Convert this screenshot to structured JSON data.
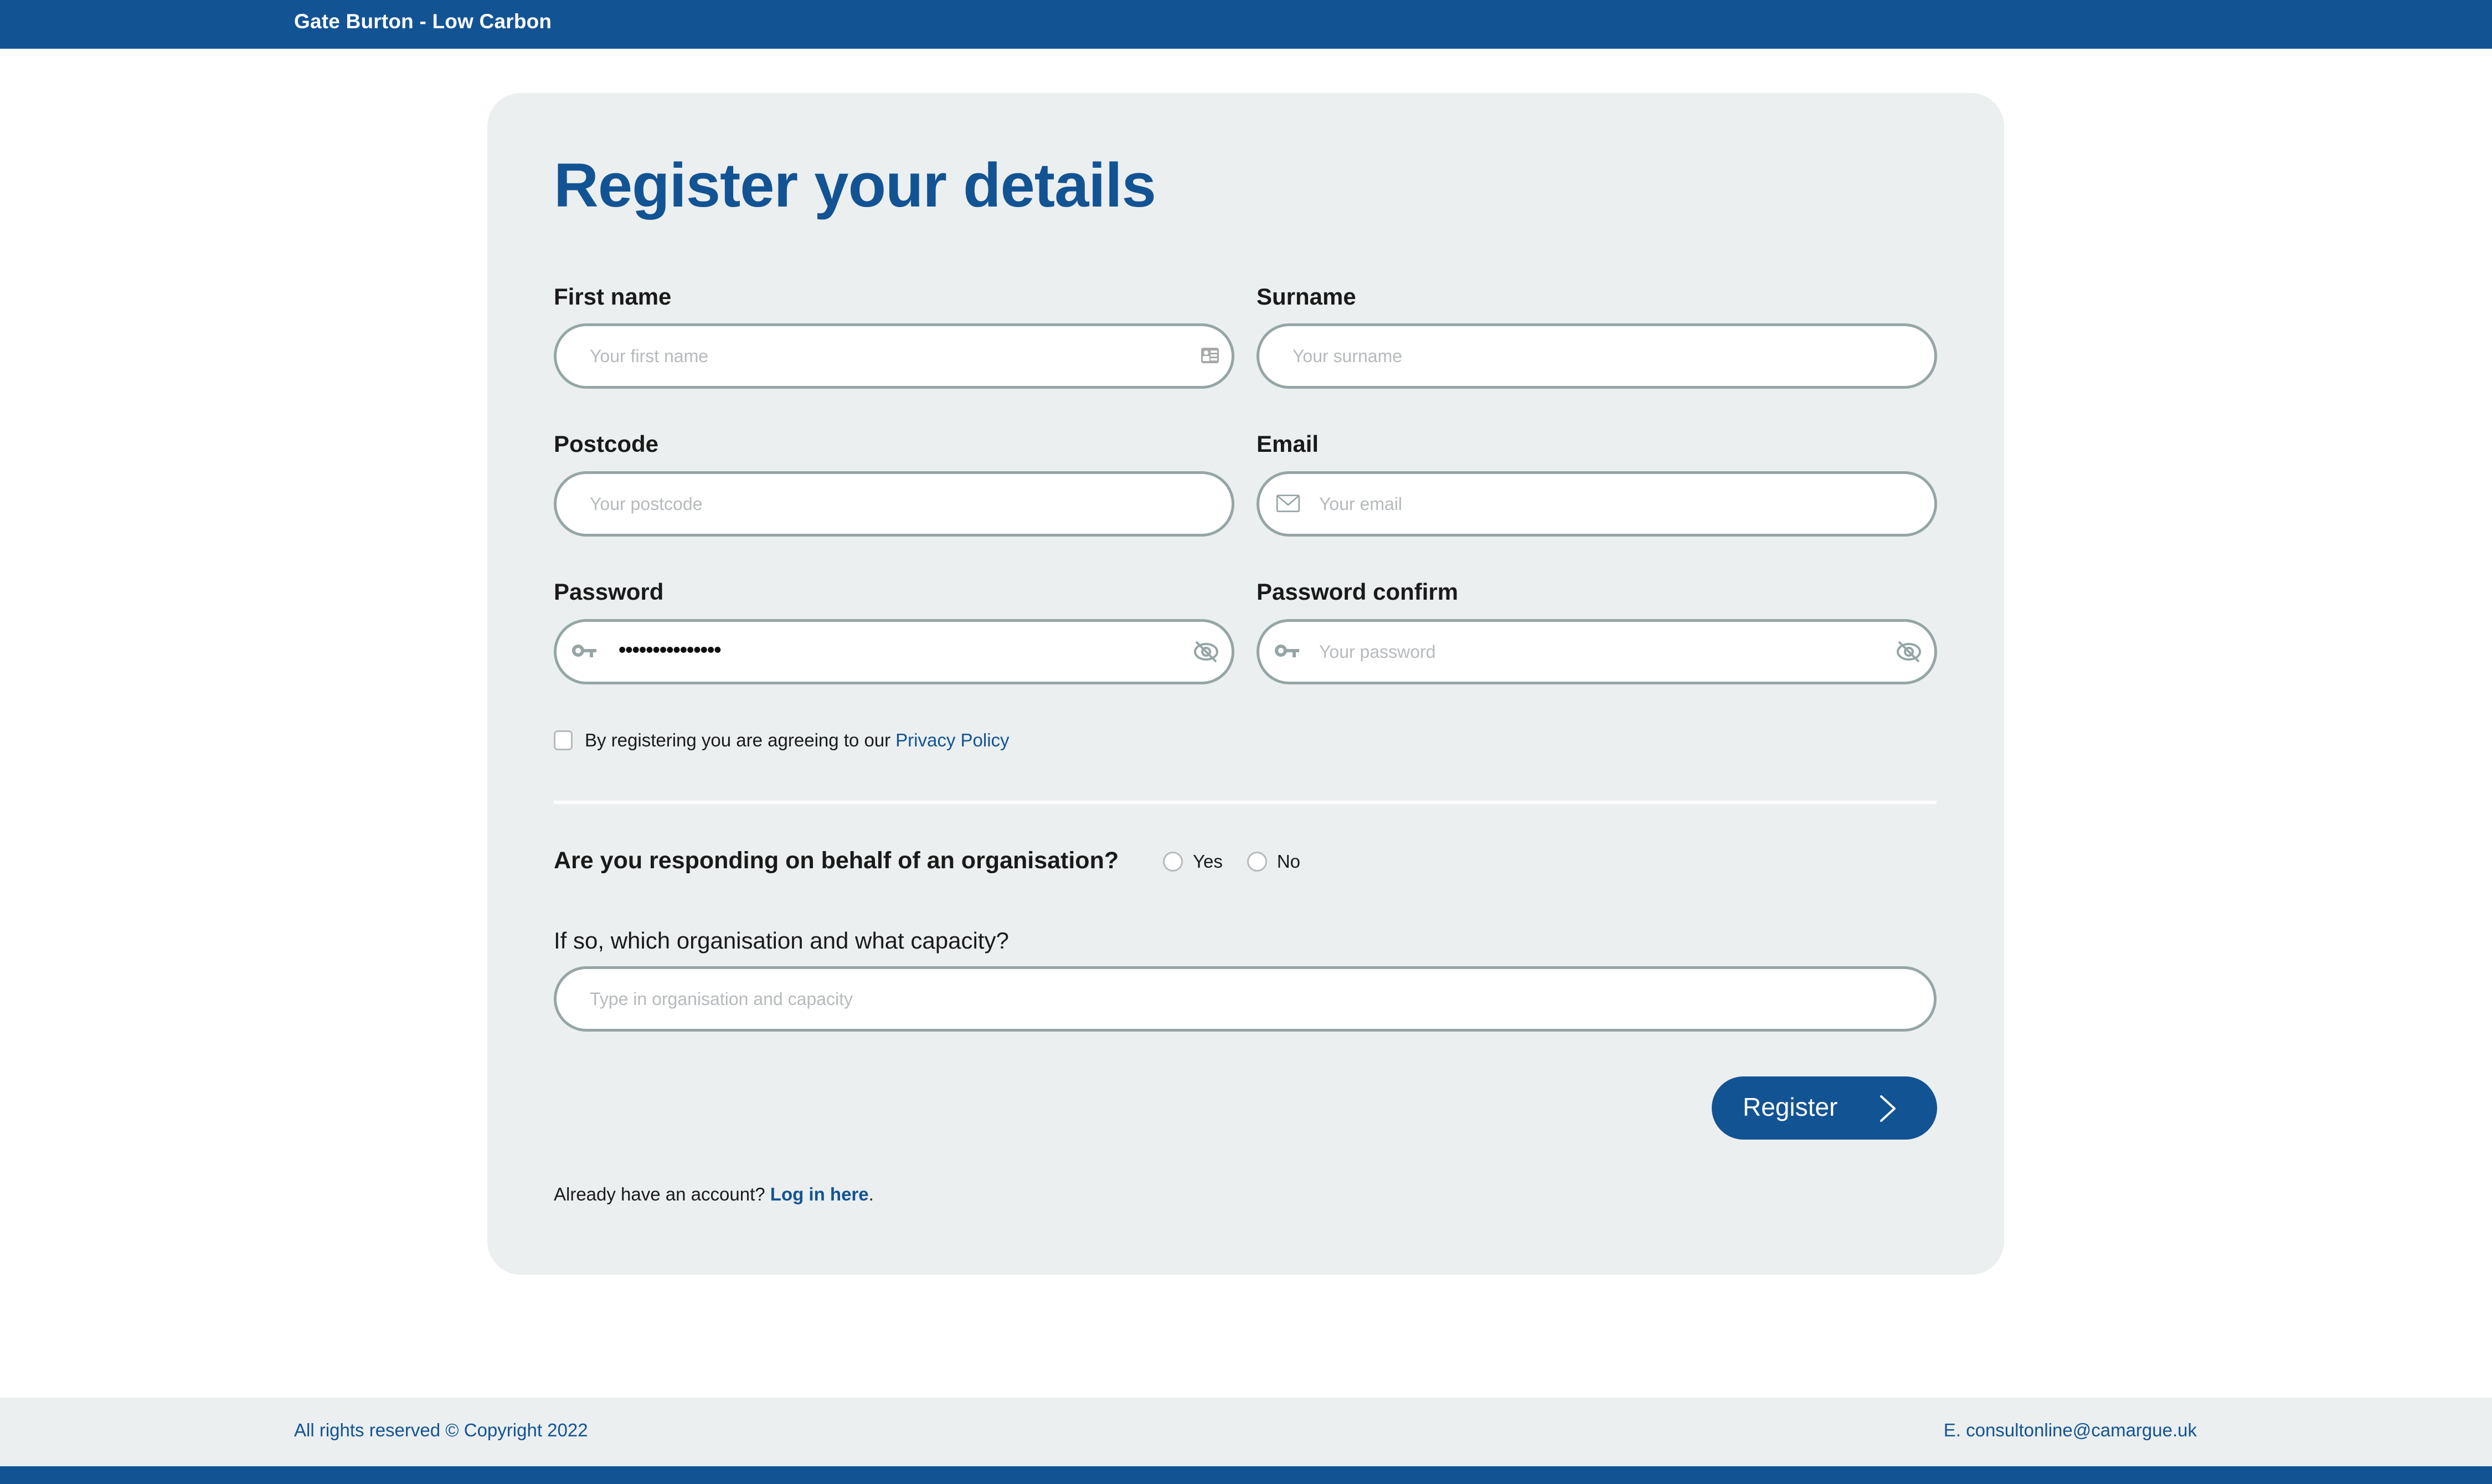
{
  "header": {
    "site_title": "Gate Burton - Low Carbon"
  },
  "page": {
    "title": "Register your details"
  },
  "form": {
    "first_name": {
      "label": "First name",
      "placeholder": "Your first name",
      "value": ""
    },
    "surname": {
      "label": "Surname",
      "placeholder": "Your surname",
      "value": ""
    },
    "postcode": {
      "label": "Postcode",
      "placeholder": "Your postcode",
      "value": ""
    },
    "email": {
      "label": "Email",
      "placeholder": "Your email",
      "value": ""
    },
    "password": {
      "label": "Password",
      "placeholder": "Your password",
      "masked_value": "•••••••••••••••"
    },
    "password_confirm": {
      "label": "Password confirm",
      "placeholder": "Your password",
      "value": ""
    },
    "consent": {
      "text": "By registering you are agreeing to our",
      "link_label": "Privacy Policy",
      "checked": false
    },
    "organisation": {
      "question": "Are you responding on behalf of an organisation?",
      "options": [
        {
          "label": "Yes",
          "selected": false
        },
        {
          "label": "No",
          "selected": false
        }
      ],
      "detail_label": "If so, which organisation and what capacity?",
      "detail_placeholder": "Type in organisation and capacity"
    },
    "submit_label": "Register",
    "login_prompt": "Already have an account?",
    "login_link": "Log in here",
    "login_suffix": "."
  },
  "footer": {
    "copyright": "All rights reserved © Copyright 2022",
    "email": "E. consultonline@camargue.uk"
  },
  "colors": {
    "brand": "#125394",
    "card_bg": "#ebeff0",
    "field_border": "#96a5a5"
  }
}
